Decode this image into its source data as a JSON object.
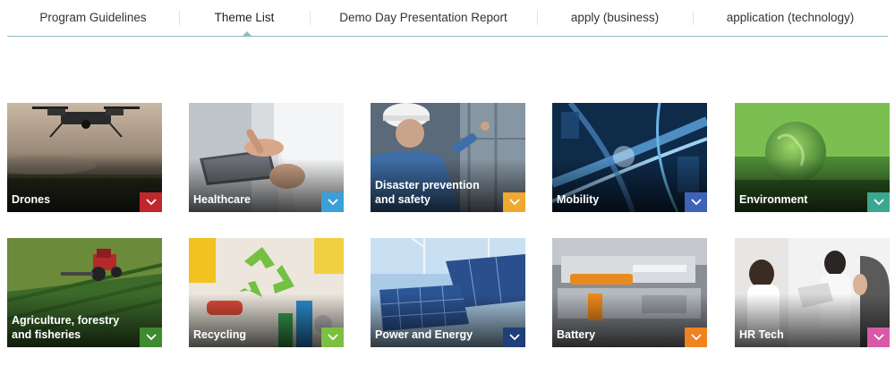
{
  "nav": {
    "items": [
      {
        "label": "Program Guidelines"
      },
      {
        "label": "Theme List"
      },
      {
        "label": "Demo Day Presentation Report"
      },
      {
        "label": "apply (business)"
      },
      {
        "label": "application (technology)"
      }
    ],
    "active_index": 1,
    "accent": "#8fbcc7"
  },
  "themes": [
    {
      "label": "Drones",
      "accent": "#c0272d",
      "icon": "chevron-down-icon"
    },
    {
      "label": "Healthcare",
      "accent": "#3aa0d8",
      "icon": "chevron-down-icon"
    },
    {
      "label": "Disaster prevention and safety",
      "accent": "#f0a830",
      "icon": "chevron-down-icon"
    },
    {
      "label": "Mobility",
      "accent": "#3d63b8",
      "icon": "chevron-down-icon"
    },
    {
      "label": "Environment",
      "accent": "#3aa890",
      "icon": "chevron-down-icon"
    },
    {
      "label": "Agriculture, forestry and fisheries",
      "accent": "#3f8a30",
      "icon": "chevron-down-icon"
    },
    {
      "label": "Recycling",
      "accent": "#7cc040",
      "icon": "chevron-down-icon"
    },
    {
      "label": "Power and Energy",
      "accent": "#1e3f78",
      "icon": "chevron-down-icon"
    },
    {
      "label": "Battery",
      "accent": "#ee8320",
      "icon": "chevron-down-icon"
    },
    {
      "label": "HR Tech",
      "accent": "#d85aa6",
      "icon": "chevron-down-icon"
    }
  ]
}
